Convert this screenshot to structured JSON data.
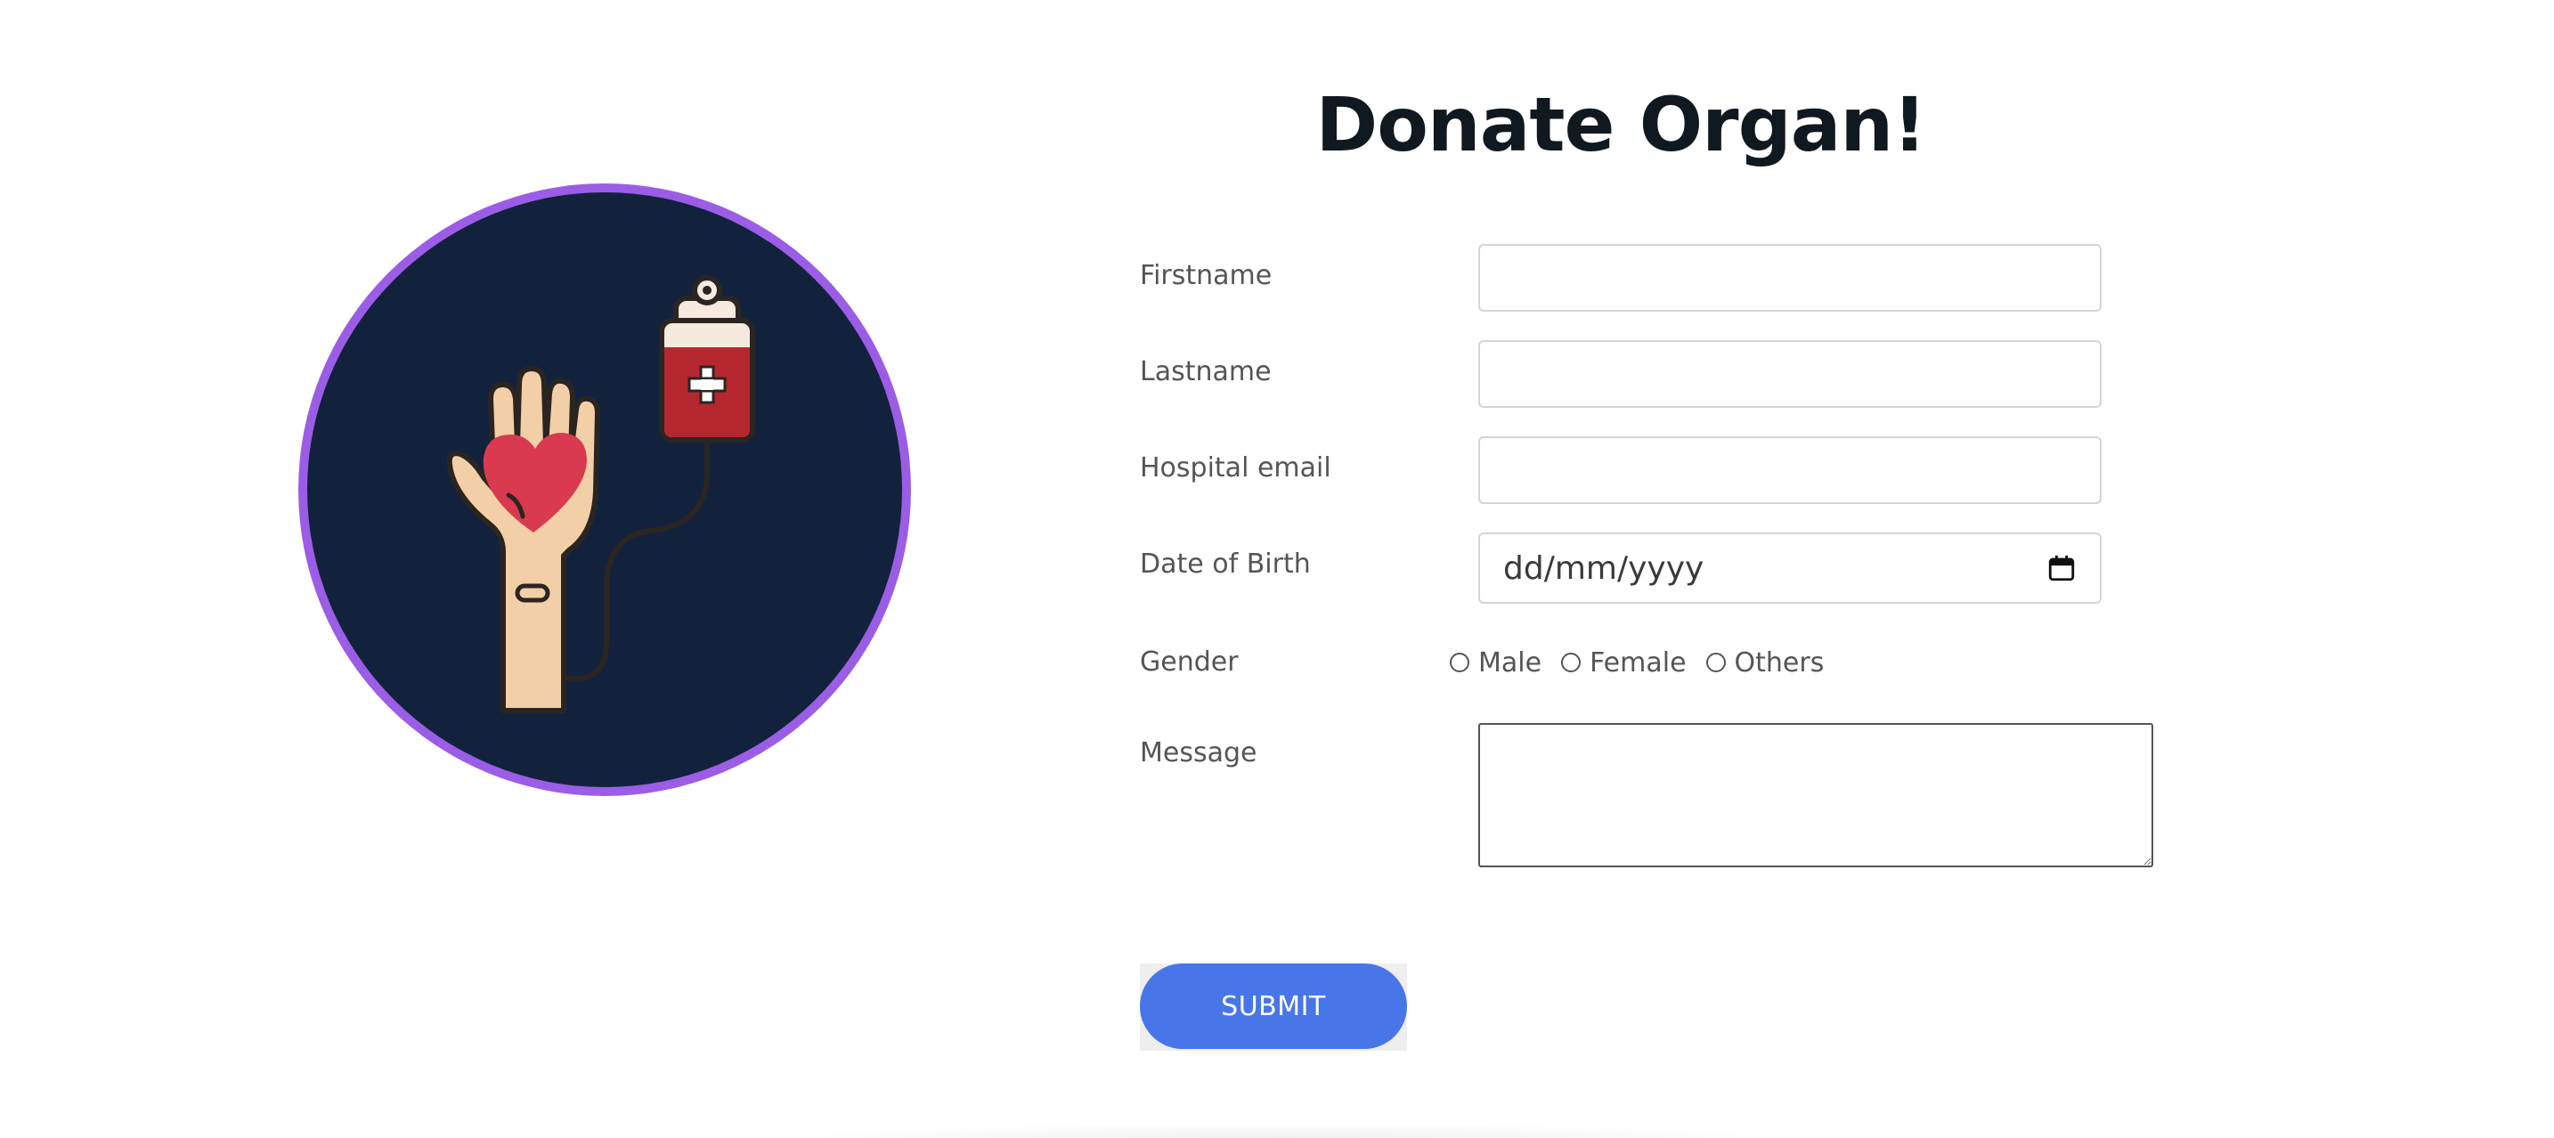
{
  "page": {
    "title": "Donate Organ!"
  },
  "form": {
    "firstname": {
      "label": "Firstname",
      "value": ""
    },
    "lastname": {
      "label": "Lastname",
      "value": ""
    },
    "hospital_email": {
      "label": "Hospital email",
      "value": ""
    },
    "date_of_birth": {
      "label": "Date of Birth",
      "placeholder": "dd/mm/yyyy"
    },
    "gender": {
      "label": "Gender",
      "options": [
        "Male",
        "Female",
        "Others"
      ]
    },
    "message": {
      "label": "Message",
      "value": ""
    },
    "submit_label": "SUBMIT"
  },
  "colors": {
    "accent_button": "#4876e8",
    "illustration_ring": "#9b5de5",
    "illustration_background": "#12223d",
    "heart": "#d93a4f",
    "blood_bag": "#b5272e"
  },
  "icons": {
    "illustration": "hand-heart-blood-bag-icon",
    "date_picker": "calendar-icon"
  }
}
